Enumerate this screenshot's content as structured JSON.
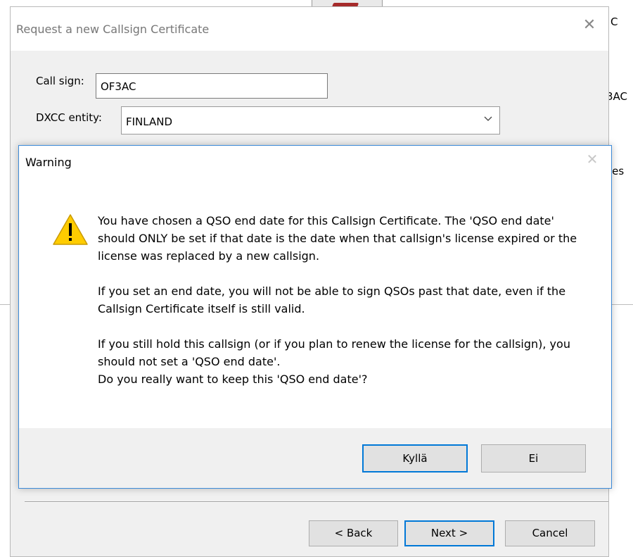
{
  "background_window": {
    "fragments": [
      "C",
      "3AC",
      "ies"
    ]
  },
  "request_dialog": {
    "title": "Request a new Callsign Certificate",
    "close_glyph": "✕",
    "callsign_label": "Call sign:",
    "callsign_value": "OF3AC",
    "dxcc_label": "DXCC entity:",
    "dxcc_value": "FINLAND",
    "buttons": {
      "back": "< Back",
      "next": "Next >",
      "cancel": "Cancel"
    }
  },
  "warning_dialog": {
    "title": "Warning",
    "close_glyph": "✕",
    "icon": "warning-icon",
    "paragraphs": [
      "You have chosen a QSO end date for this Callsign Certificate. The 'QSO end date' should ONLY be set if that date is the date when that callsign's license expired or the license was replaced by a new callsign.",
      "If you set an end date, you will not be able to sign QSOs past that date, even if the Callsign Certificate itself is still valid.",
      "If you still hold this callsign (or if you plan to renew the license for the callsign), you should not set a 'QSO end date'.",
      "Do you really want to keep this 'QSO end date'?"
    ],
    "buttons": {
      "yes": "Kyllä",
      "no": "Ei"
    }
  },
  "colors": {
    "accent": "#0078d7",
    "warning_yellow": "#ffcc00",
    "dialog_bg": "#f0f0f0"
  }
}
